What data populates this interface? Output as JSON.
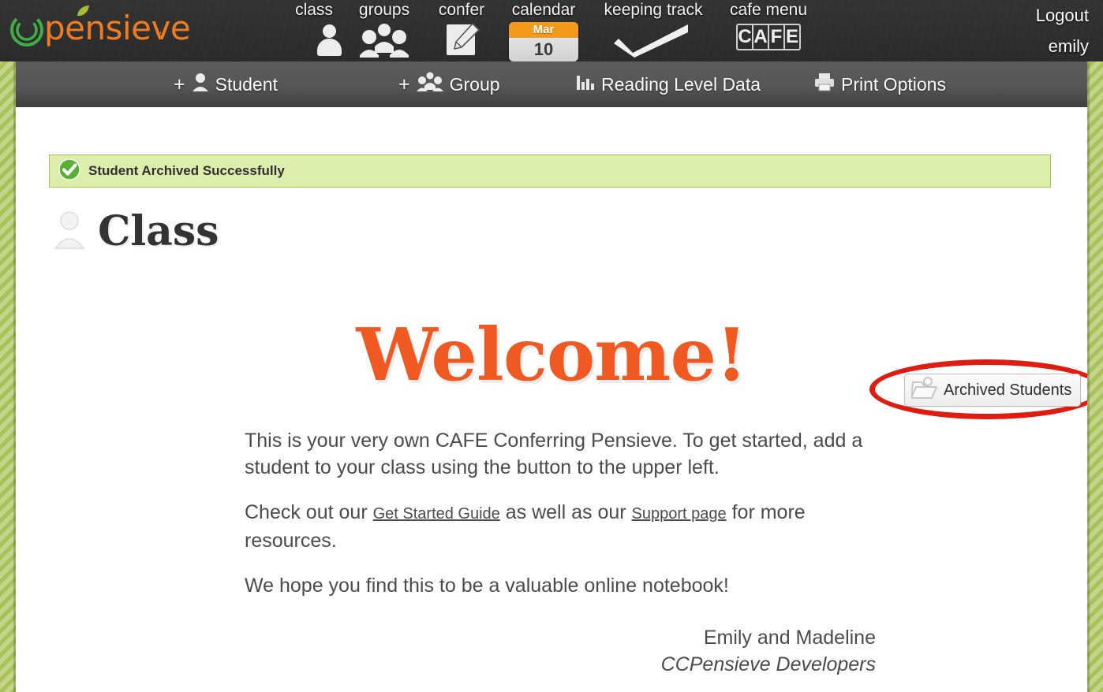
{
  "app": {
    "logo_text": "pensieve",
    "logo_tm": "™",
    "brand_orange": "#f07c22",
    "brand_green": "#3fae49"
  },
  "topnav": {
    "items": [
      {
        "label": "class",
        "icon": "person-icon"
      },
      {
        "label": "groups",
        "icon": "people-group-icon"
      },
      {
        "label": "confer",
        "icon": "note-pencil-icon"
      },
      {
        "label": "calendar",
        "icon": "calendar-icon"
      },
      {
        "label": "keeping track",
        "icon": "checkmark-icon"
      },
      {
        "label": "cafe menu",
        "icon": "cafe-icon"
      }
    ],
    "calendar": {
      "month": "Mar",
      "day": "10"
    },
    "cafe_letters": [
      "C",
      "A",
      "F",
      "E"
    ]
  },
  "account": {
    "logout_label": "Logout",
    "username": "emily"
  },
  "subnav": {
    "items": [
      {
        "label": "Student",
        "prefix": "+",
        "icon": "add-student-icon"
      },
      {
        "label": "Group",
        "prefix": "+",
        "icon": "add-group-icon"
      },
      {
        "label": "Reading Level Data",
        "prefix": "",
        "icon": "bar-chart-icon"
      },
      {
        "label": "Print Options",
        "prefix": "",
        "icon": "printer-icon"
      }
    ]
  },
  "banner": {
    "message": "Student Archived Successfully",
    "icon": "success-check-icon",
    "bg_color": "#ddeeac",
    "border_color": "#a8c24b",
    "check_color": "#59b036"
  },
  "page": {
    "title": "Class",
    "title_icon": "person-icon"
  },
  "archived": {
    "button_label": "Archived Students",
    "icon": "archive-folder-icon",
    "highlight_color": "#e01b10"
  },
  "main": {
    "welcome_heading": "Welcome!",
    "welcome_color": "#f05a22",
    "paragraph1": "This is your very own CAFE Conferring Pensieve. To get started, add a student to your class using the button to the upper left.",
    "paragraph2_part1": "Check out our ",
    "paragraph2_link1": "Get Started Guide",
    "paragraph2_part2": " as well as our ",
    "paragraph2_link2": "Support page",
    "paragraph2_part3": " for more resources.",
    "paragraph3": "We hope you find this to be a valuable online notebook!",
    "signature_line1": "Emily and Madeline",
    "signature_line2": "CCPensieve Developers"
  }
}
